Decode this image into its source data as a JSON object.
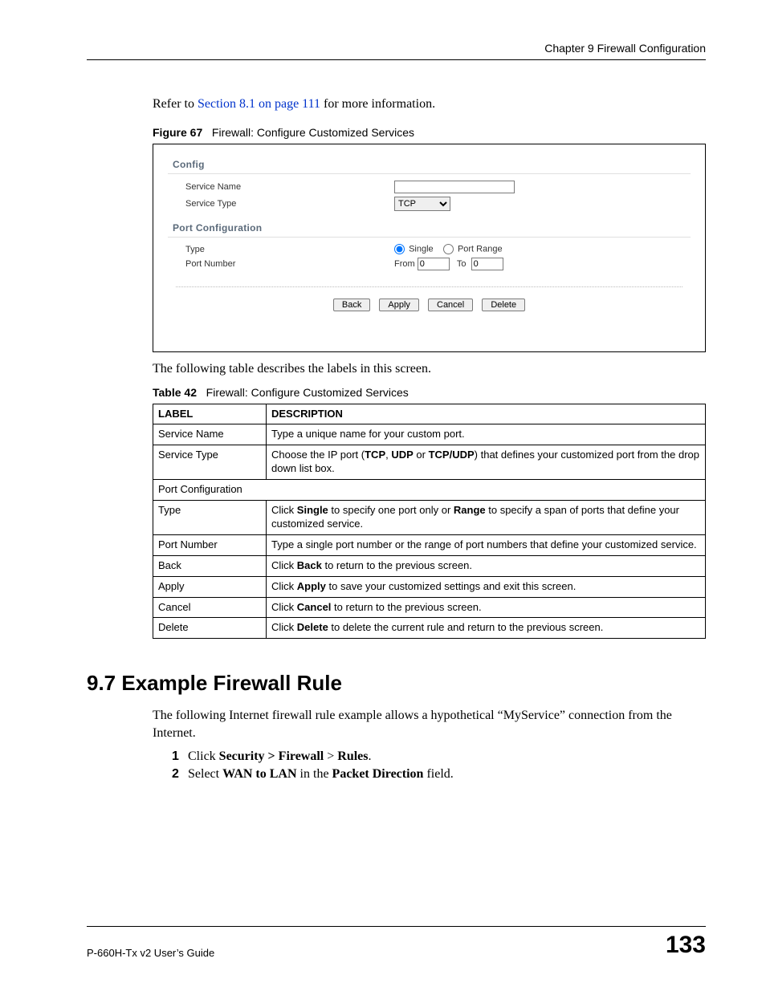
{
  "header": {
    "chapter": "Chapter 9 Firewall Configuration"
  },
  "intro": {
    "prefix": "Refer to ",
    "link": "Section 8.1 on page 111",
    "suffix": " for more information."
  },
  "figure": {
    "label": "Figure 67",
    "title": "Firewall: Configure Customized Services",
    "sections": {
      "config": "Config",
      "port_config": "Port Configuration"
    },
    "labels": {
      "service_name": "Service Name",
      "service_type": "Service Type",
      "type": "Type",
      "port_number": "Port Number",
      "single": "Single",
      "port_range": "Port Range",
      "from": "From",
      "to": "To"
    },
    "values": {
      "service_name": "",
      "service_type": "TCP",
      "from": "0",
      "to": "0"
    },
    "buttons": {
      "back": "Back",
      "apply": "Apply",
      "cancel": "Cancel",
      "delete": "Delete"
    }
  },
  "mid_text": "The following table describes the labels in this screen.",
  "table": {
    "label": "Table 42",
    "title": "Firewall: Configure Customized Services",
    "headers": {
      "label": "LABEL",
      "desc": "DESCRIPTION"
    },
    "rows": [
      {
        "label": "Service Name",
        "desc": "Type a unique name for your custom port."
      },
      {
        "label": "Service Type",
        "desc_parts": [
          "Choose the IP port (",
          "TCP",
          ", ",
          "UDP",
          " or ",
          "TCP/UDP",
          ") that defines your customized port from the drop down list box."
        ]
      },
      {
        "span": "Port Configuration"
      },
      {
        "label": "Type",
        "desc_parts": [
          "Click ",
          "Single",
          " to specify one port only or ",
          "Range",
          " to specify a span of ports that define your customized service."
        ]
      },
      {
        "label": "Port Number",
        "desc": "Type a single port number or the range of port numbers that define your customized service."
      },
      {
        "label": "Back",
        "desc_parts": [
          "Click ",
          "Back",
          " to return to the previous screen."
        ]
      },
      {
        "label": "Apply",
        "desc_parts": [
          "Click ",
          "Apply",
          " to save your customized settings and exit this screen."
        ]
      },
      {
        "label": "Cancel",
        "desc_parts": [
          "Click ",
          "Cancel",
          " to return to the previous screen."
        ]
      },
      {
        "label": "Delete",
        "desc_parts": [
          "Click ",
          "Delete",
          " to delete the current rule and return to the previous screen."
        ]
      }
    ]
  },
  "section97": {
    "heading": "9.7  Example Firewall Rule",
    "para": "The following Internet firewall rule example allows a hypothetical “MyService” connection from the Internet.",
    "steps": [
      {
        "n": "1",
        "parts": [
          "Click ",
          "Security > Firewall",
          " > ",
          "Rules",
          "."
        ]
      },
      {
        "n": "2",
        "parts": [
          "Select ",
          "WAN to LAN",
          " in the ",
          "Packet Direction",
          " field."
        ]
      }
    ]
  },
  "footer": {
    "guide": "P-660H-Tx v2 User’s Guide",
    "page": "133"
  }
}
